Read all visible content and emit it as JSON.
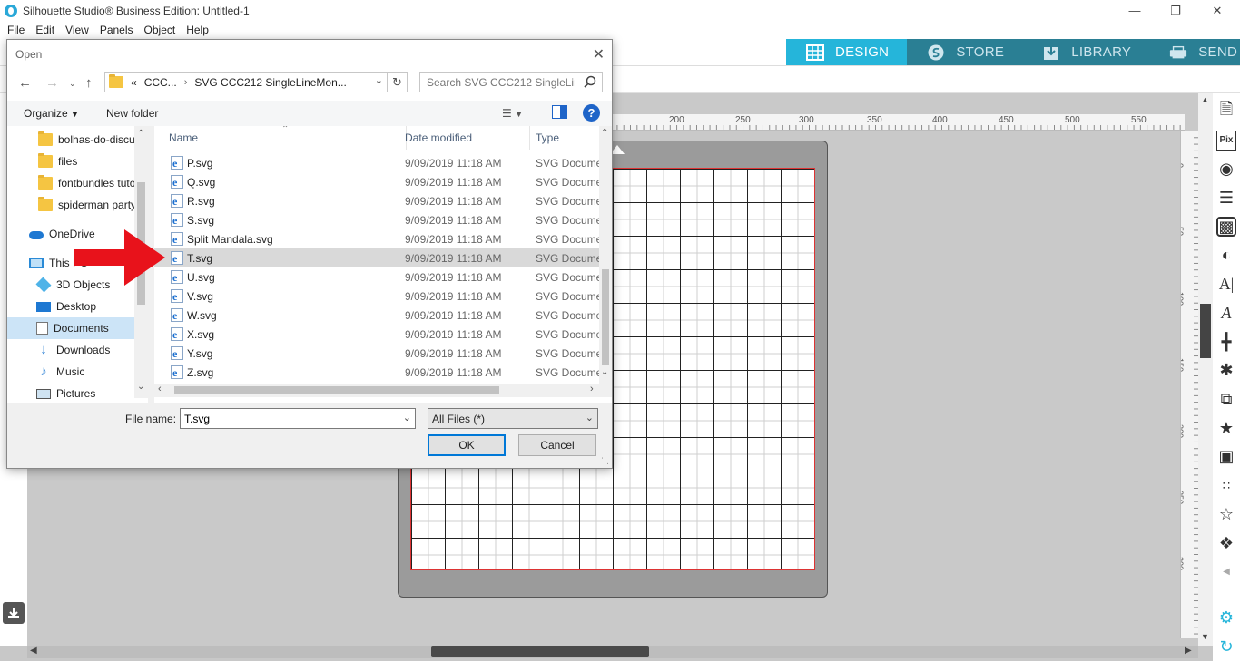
{
  "app": {
    "title": "Silhouette Studio® Business Edition: Untitled-1",
    "menu": [
      "File",
      "Edit",
      "View",
      "Panels",
      "Object",
      "Help"
    ],
    "window_controls": [
      "minimize-icon",
      "restore-icon",
      "close-icon"
    ],
    "mode_tabs": [
      {
        "label": "DESIGN",
        "icon": "grid-icon",
        "active": true
      },
      {
        "label": "STORE",
        "icon": "silhouette-s-icon",
        "active": false
      },
      {
        "label": "LIBRARY",
        "icon": "download-box-icon",
        "active": false
      },
      {
        "label": "SEND",
        "icon": "printer-icon",
        "active": false
      }
    ],
    "accent_color": "#25b5da",
    "ruler_top_ticks": [
      "200",
      "250",
      "300",
      "350",
      "400",
      "450",
      "500",
      "550"
    ],
    "ruler_right_ticks": [
      "0",
      "50",
      "100",
      "150",
      "200",
      "250",
      "300"
    ]
  },
  "dialog": {
    "title": "Open",
    "address": {
      "crumbs": [
        "«",
        "CCC...",
        "SVG CCC212 SingleLineMon..."
      ]
    },
    "search_placeholder": "Search SVG CCC212 SingleLin...",
    "organize_label": "Organize",
    "new_folder_label": "New folder",
    "nav_items": [
      {
        "label": "bolhas-do-discu",
        "icon": "folder-icon"
      },
      {
        "label": "files",
        "icon": "folder-icon"
      },
      {
        "label": "fontbundles tuto",
        "icon": "folder-icon"
      },
      {
        "label": "spiderman party",
        "icon": "folder-icon"
      },
      {
        "label": "OneDrive",
        "icon": "cloud-icon"
      },
      {
        "label": "This PC",
        "icon": "computer-icon"
      },
      {
        "label": "3D Objects",
        "icon": "cube-icon"
      },
      {
        "label": "Desktop",
        "icon": "desktop-icon"
      },
      {
        "label": "Documents",
        "icon": "document-icon"
      },
      {
        "label": "Downloads",
        "icon": "download-arrow-icon"
      },
      {
        "label": "Music",
        "icon": "music-note-icon"
      },
      {
        "label": "Pictures",
        "icon": "picture-icon"
      }
    ],
    "columns": {
      "name": "Name",
      "date": "Date modified",
      "type": "Type"
    },
    "files": [
      {
        "name": "P.svg",
        "date": "9/09/2019 11:18 AM",
        "type": "SVG Docume"
      },
      {
        "name": "Q.svg",
        "date": "9/09/2019 11:18 AM",
        "type": "SVG Docume"
      },
      {
        "name": "R.svg",
        "date": "9/09/2019 11:18 AM",
        "type": "SVG Docume"
      },
      {
        "name": "S.svg",
        "date": "9/09/2019 11:18 AM",
        "type": "SVG Docume"
      },
      {
        "name": "Split Mandala.svg",
        "date": "9/09/2019 11:18 AM",
        "type": "SVG Docume"
      },
      {
        "name": "T.svg",
        "date": "9/09/2019 11:18 AM",
        "type": "SVG Docume",
        "selected": true
      },
      {
        "name": "U.svg",
        "date": "9/09/2019 11:18 AM",
        "type": "SVG Docume"
      },
      {
        "name": "V.svg",
        "date": "9/09/2019 11:18 AM",
        "type": "SVG Docume"
      },
      {
        "name": "W.svg",
        "date": "9/09/2019 11:18 AM",
        "type": "SVG Docume"
      },
      {
        "name": "X.svg",
        "date": "9/09/2019 11:18 AM",
        "type": "SVG Docume"
      },
      {
        "name": "Y.svg",
        "date": "9/09/2019 11:18 AM",
        "type": "SVG Docume"
      },
      {
        "name": "Z.svg",
        "date": "9/09/2019 11:18 AM",
        "type": "SVG Docume"
      }
    ],
    "file_name_label": "File name:",
    "file_name_value": "T.svg",
    "file_type_value": "All Files (*)",
    "ok_label": "OK",
    "cancel_label": "Cancel",
    "pointer_color": "#e8121b"
  }
}
